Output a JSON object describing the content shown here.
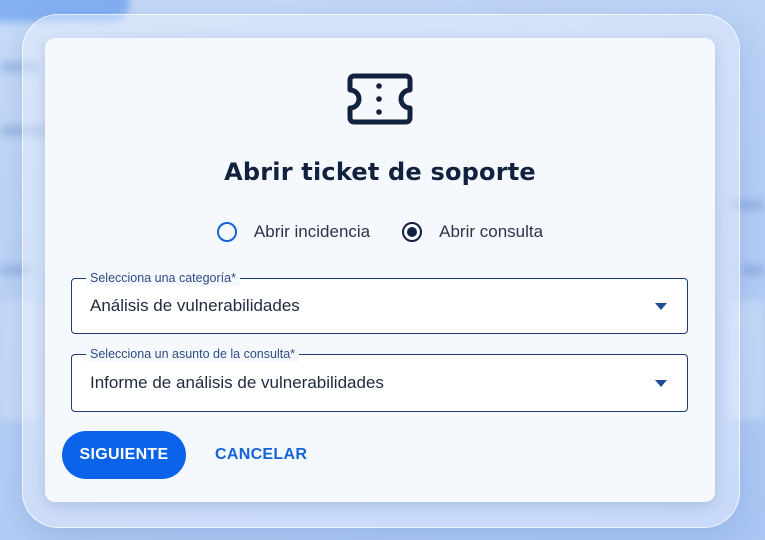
{
  "dialog": {
    "icon": "ticket-icon",
    "title": "Abrir ticket de soporte",
    "radio_options": [
      {
        "label": "Abrir incidencia",
        "checked": false
      },
      {
        "label": "Abrir consulta",
        "checked": true
      }
    ],
    "fields": [
      {
        "label": "Selecciona una categoría*",
        "value": "Análisis de vulnerabilidades"
      },
      {
        "label": "Selecciona un asunto de la consulta*",
        "value": "Informe de análisis de vulnerabilidades"
      }
    ],
    "buttons": {
      "next_label": "SIGUIENTE",
      "cancel_label": "CANCELAR"
    }
  },
  "colors": {
    "primary": "#0a63e8",
    "title_text": "#12213d",
    "field_border": "#1e3c78",
    "dialog_bg": "#f5f8fd"
  }
}
